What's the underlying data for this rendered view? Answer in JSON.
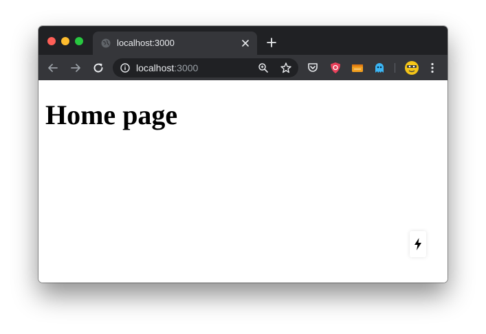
{
  "browser": {
    "tab": {
      "title": "localhost:3000",
      "favicon": "globe-icon"
    },
    "address_bar": {
      "host": "localhost",
      "port": ":3000"
    },
    "colors": {
      "tabbar": "#202124",
      "toolbar": "#35363a",
      "text": "#e8eaed"
    }
  },
  "page": {
    "heading": "Home page",
    "widget_icon": "lightning-icon"
  },
  "icons": [
    "back-icon",
    "forward-icon",
    "reload-icon",
    "info-icon",
    "zoom-icon",
    "star-icon",
    "pocket-icon",
    "shield-extension-icon",
    "wallet-extension-icon",
    "ghost-extension-icon",
    "avatar",
    "menu-icon",
    "close-icon",
    "plus-icon"
  ]
}
